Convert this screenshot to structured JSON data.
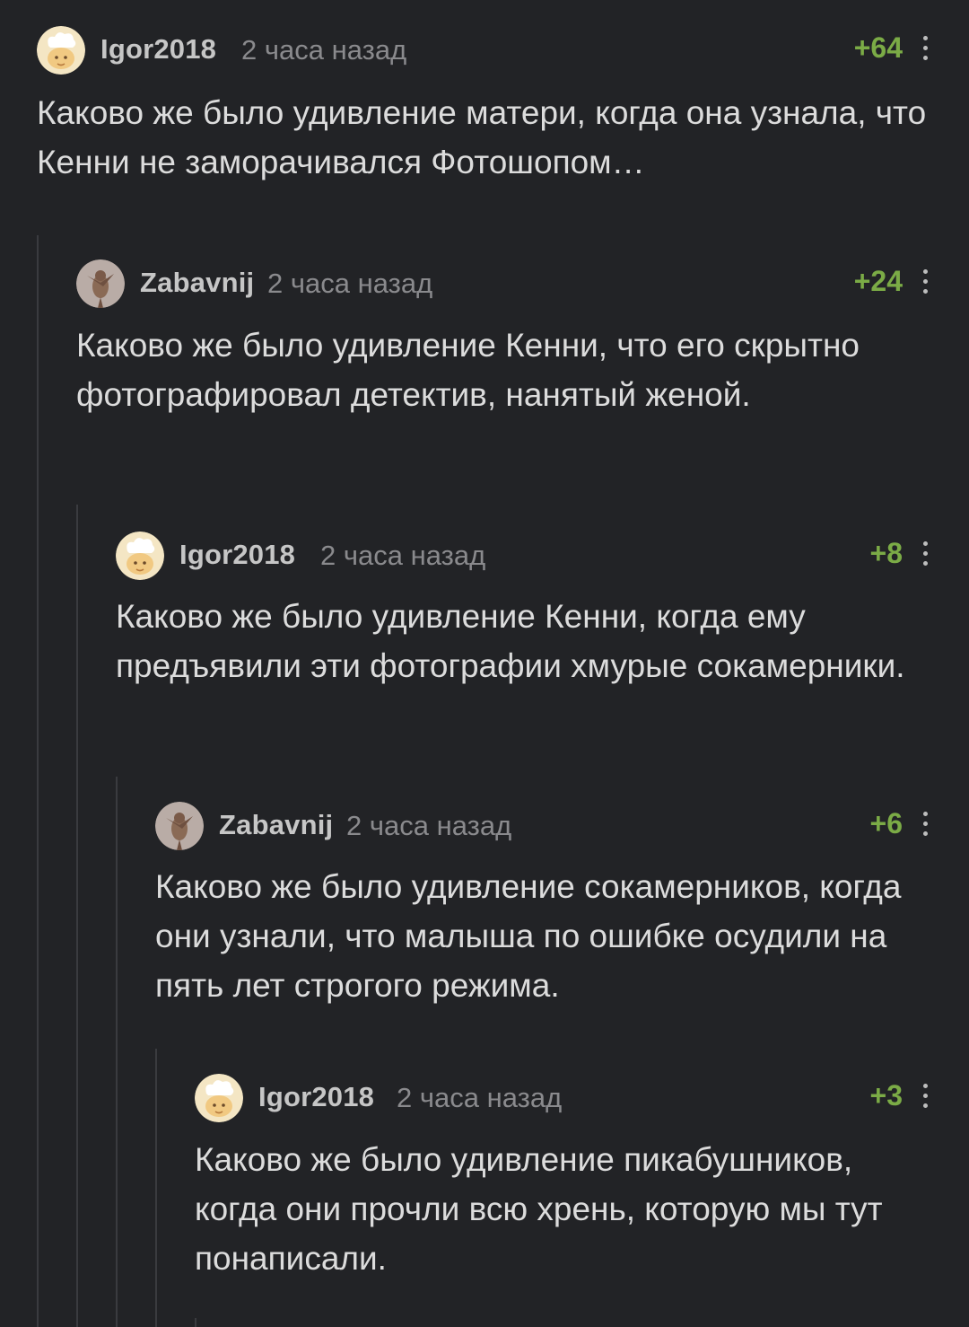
{
  "comments": [
    {
      "author": "Igor2018",
      "time": "2 часа назад",
      "rating": "+64",
      "avatar": "chef-avatar-icon",
      "text": "Каково же было удивление матери, когда она узнала, что Кенни не заморачивался Фотошопом…"
    },
    {
      "author": "Zabavnij",
      "time": "2 часа назад",
      "rating": "+24",
      "avatar": "bird-avatar-icon",
      "text": "Каково же было удивление Кенни, что его скрытно фотографировал детектив, нанятый женой."
    },
    {
      "author": "Igor2018",
      "time": "2 часа назад",
      "rating": "+8",
      "avatar": "chef-avatar-icon",
      "text": "Каково же было удивление Кенни, когда ему предъявили эти фотографии хмурые сокамерники."
    },
    {
      "author": "Zabavnij",
      "time": "2 часа назад",
      "rating": "+6",
      "avatar": "bird-avatar-icon",
      "text": "Каково же было удивление сокамерников, когда они узнали, что малыша по ошибке осудили на пять лет строгого режима."
    },
    {
      "author": "Igor2018",
      "time": "2 часа назад",
      "rating": "+3",
      "avatar": "chef-avatar-icon",
      "text": "Каково же было удивление пикабушников, когда они прочли всю хрень, которую мы тут понаписали."
    }
  ],
  "colors": {
    "background": "#222326",
    "rating_positive": "#7bab46",
    "thread_line": "#3a3b3f"
  }
}
